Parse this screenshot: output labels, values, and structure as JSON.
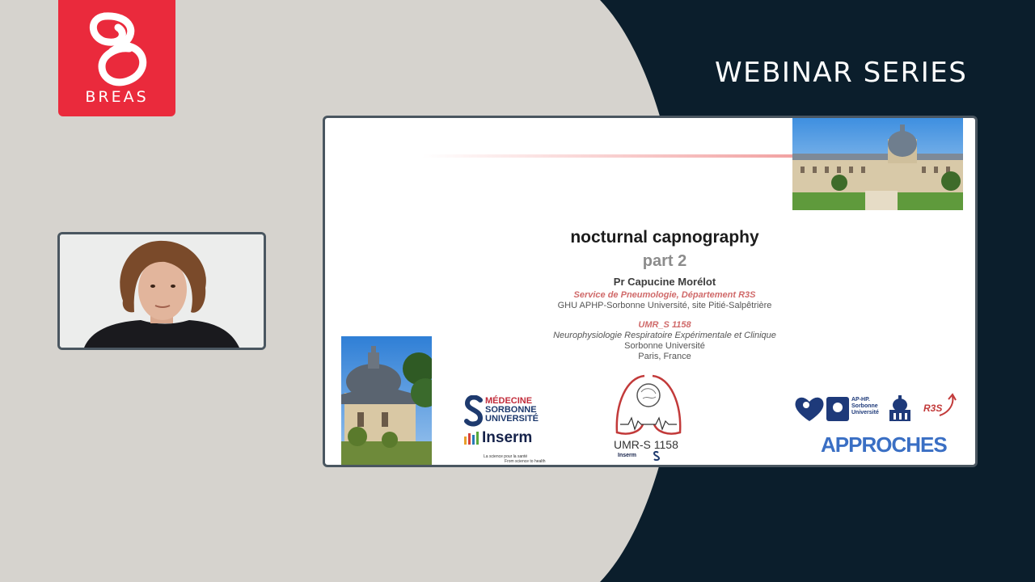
{
  "brand": {
    "name": "BREAS",
    "icon": "breas-b-logo-icon",
    "color": "#ea2a3c"
  },
  "header": {
    "title": "WEBINAR SERIES"
  },
  "colors": {
    "background_dark": "#0b1e2c",
    "background_light": "#d6d3ce",
    "frame": "#4a5660"
  },
  "webcam": {
    "icon": "presenter-video-feed"
  },
  "slide": {
    "title": "nocturnal capnography",
    "subtitle": "part 2",
    "author": "Pr Capucine Morélot",
    "affiliations": [
      {
        "text": "Service de Pneumologie, Département R3S",
        "style": "red"
      },
      {
        "text": "GHU APHP-Sorbonne Université, site Pitié-Salpêtrière",
        "style": "plain"
      },
      {
        "text": "UMR_S 1158",
        "style": "red"
      },
      {
        "text": "Neurophysiologie Respiratoire Expérimentale et Clinique",
        "style": "italic"
      },
      {
        "text": "Sorbonne Université",
        "style": "plain"
      },
      {
        "text": "Paris, France",
        "style": "plain"
      }
    ],
    "logos": {
      "medecine": [
        "MÉDECINE",
        "SORBONNE",
        "UNIVERSITÉ"
      ],
      "inserm": "Inserm",
      "inserm_tagline": [
        "La science pour la santé",
        "From science to health"
      ],
      "umr": "UMR-S 1158",
      "umr_inserm": "Inserm",
      "aphp": [
        "AP-HP.",
        "Sorbonne",
        "Université"
      ],
      "r3s": "R3S",
      "approches": "APPROCHES"
    }
  }
}
